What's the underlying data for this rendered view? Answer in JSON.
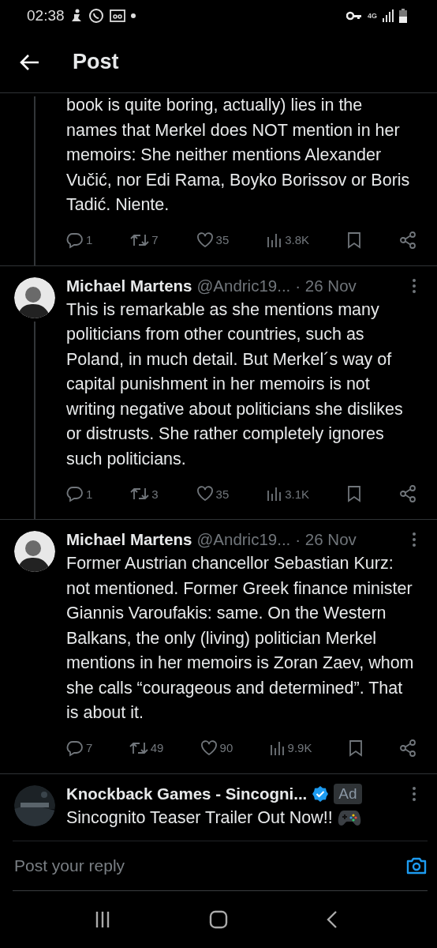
{
  "status_bar": {
    "time": "02:38",
    "network": "4G"
  },
  "header": {
    "title": "Post"
  },
  "posts": [
    {
      "kind": "continued",
      "text": "book is quite boring, actually) lies in the names that Merkel does NOT mention in her memoirs: She neither mentions Alexander Vučić, nor Edi Rama, Boyko Borissov or Boris Tadić. Niente.",
      "thread_line": true,
      "stats": {
        "replies": "1",
        "reposts": "7",
        "likes": "35",
        "views": "3.8K"
      }
    },
    {
      "kind": "reply",
      "name": "Michael Martens",
      "handle": "@Andric19...",
      "date": "· 26 Nov",
      "text": "This is remarkable as she mentions many politicians from other countries, such as Poland, in much detail. But Merkel´s way of capital punishment in her memoirs is not writing negative about politicians she dislikes or distrusts. She rather completely ignores such politicians.",
      "thread_line": true,
      "stats": {
        "replies": "1",
        "reposts": "3",
        "likes": "35",
        "views": "3.1K"
      }
    },
    {
      "kind": "reply",
      "name": "Michael Martens",
      "handle": "@Andric19...",
      "date": "· 26 Nov",
      "text": "Former Austrian chancellor Sebastian Kurz: not mentioned. Former Greek finance minister Giannis Varoufakis: same. On the Western Balkans, the only (living) politician Merkel mentions in her memoirs is Zoran Zaev, whom she calls “courageous and determined”. That is about it.",
      "thread_line": false,
      "stats": {
        "replies": "7",
        "reposts": "49",
        "likes": "90",
        "views": "9.9K"
      }
    },
    {
      "kind": "ad",
      "name": "Knockback Games - Sincogni...",
      "verified": true,
      "badge": "Ad",
      "text": "Sincognito Teaser Trailer Out Now!!",
      "thread_line": false
    }
  ],
  "reply_bar": {
    "placeholder": "Post your reply"
  }
}
